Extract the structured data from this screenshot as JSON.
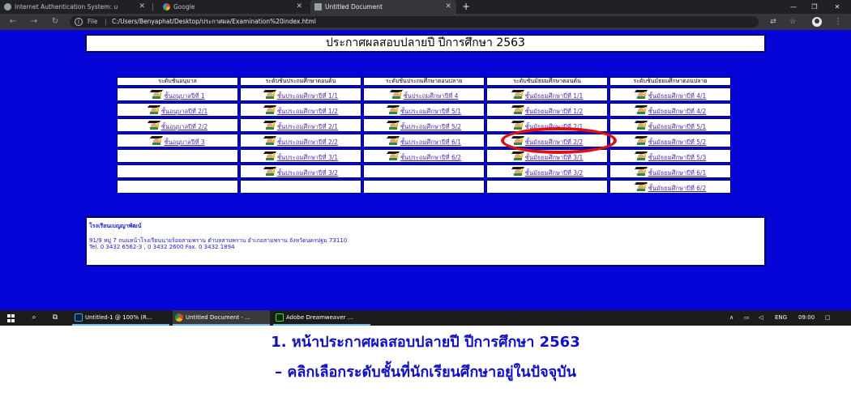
{
  "browser": {
    "tabs": [
      {
        "title": "Internet Authentication System: u",
        "icon": "globe-icon",
        "active": false
      },
      {
        "title": "Google",
        "icon": "google-icon",
        "active": false
      },
      {
        "title": "Untitled Document",
        "icon": "page-icon",
        "active": true
      }
    ],
    "new_tab_label": "+",
    "url_scheme": "File",
    "url": "C:/Users/Benyaphat/Desktop/ประกาศผล/Examination%20index.html"
  },
  "page": {
    "title": "ประกาศผลสอบปลายปี ปีการศึกษา 2563",
    "columns": [
      {
        "header": "ระดับชั้นอนุบาล",
        "items": [
          "ชั้นอนุบาลปีที่ 1",
          "ชั้นอนุบาลปีที่ 2/1",
          "ชั้นอนุบาลปีที่ 2/2",
          "ชั้นอนุบาลปีที่ 3"
        ]
      },
      {
        "header": "ระดับชั้นประถมศึกษาตอนต้น",
        "items": [
          "ชั้นประถมศึกษาปีที่ 1/1",
          "ชั้นประถมศึกษาปีที่ 1/2",
          "ชั้นประถมศึกษาปีที่ 2/1",
          "ชั้นประถมศึกษาปีที่ 2/2",
          "ชั้นประถมศึกษาปีที่ 3/1",
          "ชั้นประถมศึกษาปีที่ 3/2"
        ]
      },
      {
        "header": "ระดับชั้นประถมศึกษาตอนปลาย",
        "items": [
          "ชั้นประถมศึกษาปีที่ 4",
          "ชั้นประถมศึกษาปีที่ 5/1",
          "ชั้นประถมศึกษาปีที่ 5/2",
          "ชั้นประถมศึกษาปีที่ 6/1",
          "ชั้นประถมศึกษาปีที่ 6/2"
        ]
      },
      {
        "header": "ระดับชั้นมัธยมศึกษาตอนต้น",
        "items": [
          "ชั้นมัธยมศึกษาปีที่ 1/1",
          "ชั้นมัธยมศึกษาปีที่ 1/2",
          "ชั้นมัธยมศึกษาปีที่ 2/1",
          "ชั้นมัธยมศึกษาปีที่ 2/2",
          "ชั้นมัธยมศึกษาปีที่ 3/1",
          "ชั้นมัธยมศึกษาปีที่ 3/2"
        ]
      },
      {
        "header": "ระดับชั้นมัธยมศึกษาตอนปลาย",
        "items": [
          "ชั้นมัธยมศึกษาปีที่ 4/1",
          "ชั้นมัธยมศึกษาปีที่ 4/2",
          "ชั้นมัธยมศึกษาปีที่ 5/1",
          "ชั้นมัธยมศึกษาปีที่ 5/2",
          "ชั้นมัธยมศึกษาปีที่ 5/3",
          "ชั้นมัธยมศึกษาปีที่ 6/1",
          "ชั้นมัธยมศึกษาปีที่ 6/2"
        ]
      }
    ],
    "school": {
      "name": "โรงเรียนเบญญาพัฒน์",
      "address": "91/9 หมู่ 7 ถนนหน้าโรงเรียนนายร้อยสามพราน ตำบลสามพราน อำเภอสามพราน จังหวัดนครปฐม 73110",
      "contact": "Tel. 0 3432 6562-3 , 0 3432 2600 Fax. 0 3432 1894"
    }
  },
  "taskbar": {
    "apps": [
      {
        "label": "Untitled-1 @ 100% (R...",
        "icon": "photoshop-icon",
        "color": "#0b1e3d"
      },
      {
        "label": "Untitled Document - ...",
        "icon": "chrome-icon",
        "color": "#db4437"
      },
      {
        "label": "Adobe Dreamweaver ...",
        "icon": "dreamweaver-icon",
        "color": "#35fa00"
      }
    ],
    "lang": "ENG",
    "clock": "09:00"
  },
  "caption": {
    "line1": "1. หน้าประกาศผลสอบปลายปี ปีการศึกษา 2563",
    "line2": "– คลิกเลือกระดับชั้นที่นักเรียนศึกษาอยู่ในปัจจุบัน"
  },
  "colors": {
    "page_background": "#0505d8",
    "link": "#4d2ab0",
    "highlight": "#e01010",
    "caption_text": "#1010c0"
  }
}
